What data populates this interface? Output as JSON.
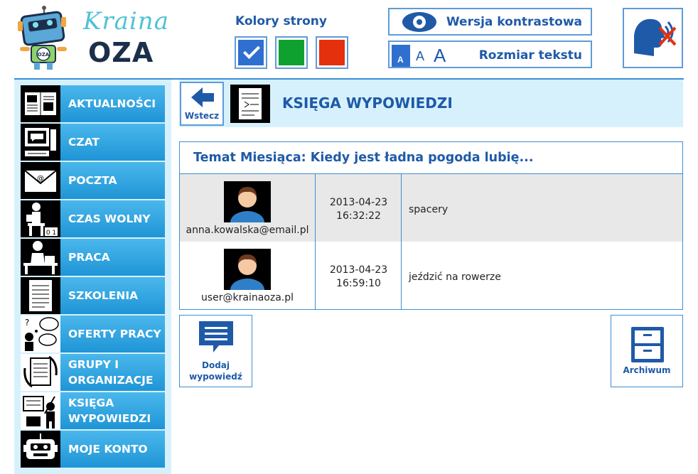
{
  "logo": {
    "line1": "Kraina",
    "line2": "OZA",
    "robot_badge": "OZA"
  },
  "colors": {
    "label": "Kolory strony",
    "swatches": [
      {
        "name": "blue",
        "color": "#2f6fd0",
        "selected": true
      },
      {
        "name": "green",
        "color": "#0ea12f",
        "selected": false
      },
      {
        "name": "red",
        "color": "#e4300c",
        "selected": false
      }
    ]
  },
  "accessibility": {
    "contrast_label": "Wersja kontrastowa",
    "text_size_label": "Rozmiar tekstu",
    "text_size_options": [
      "A",
      "A",
      "A"
    ]
  },
  "sidebar": {
    "items": [
      {
        "label": "AKTUALNOŚCI",
        "icon": "newspaper-icon"
      },
      {
        "label": "CZAT",
        "icon": "computer-chat-icon"
      },
      {
        "label": "POCZTA",
        "icon": "envelope-icon"
      },
      {
        "label": "CZAS WOLNY",
        "icon": "free-time-icon"
      },
      {
        "label": "PRACA",
        "icon": "desk-worker-icon"
      },
      {
        "label": "SZKOLENIA",
        "icon": "document-icon"
      },
      {
        "label": "OFERTY PRACY",
        "icon": "thinking-person-icon"
      },
      {
        "label": "GRUPY I\nORGANIZACJE",
        "icon": "groups-documents-icon"
      },
      {
        "label": "KSIĘGA\nWYPOWIEDZI",
        "icon": "writing-person-icon"
      },
      {
        "label": "MOJE KONTO",
        "icon": "robot-face-icon"
      }
    ]
  },
  "main": {
    "back_label": "Wstecz",
    "title": "KSIĘGA WYPOWIEDZI",
    "topic": "Temat Miesiąca: Kiedy jest ładna pogoda lubię...",
    "entries": [
      {
        "email": "anna.kowalska@email.pl",
        "datetime": "2013-04-23\n16:32:22",
        "answer": "spacery"
      },
      {
        "email": "user@krainaoza.pl",
        "datetime": "2013-04-23\n16:59:10",
        "answer": "jeździć na rowerze"
      }
    ],
    "add_label": "Dodaj\nwypowiedź",
    "archive_label": "Archiwum"
  }
}
